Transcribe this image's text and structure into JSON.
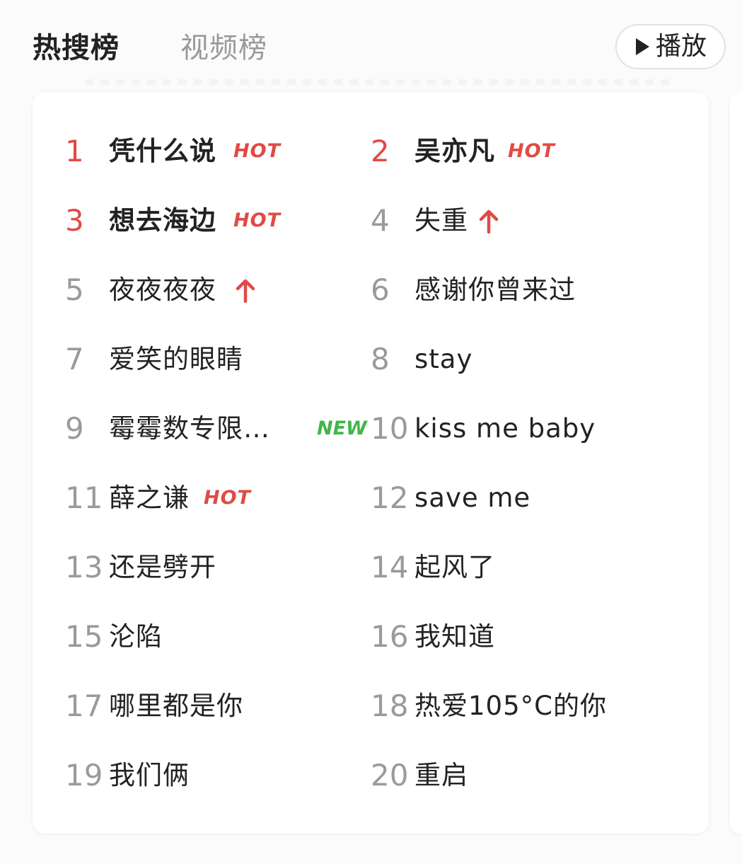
{
  "tabs": {
    "hot_search": "热搜榜",
    "video": "视频榜"
  },
  "play_button": {
    "label": "播放",
    "icon": "play-triangle-icon"
  },
  "colors": {
    "rank_top": "#e04b45",
    "rank_normal": "#9a9a9a",
    "hot_badge": "#e04b45",
    "new_badge": "#42b54a",
    "arrow_up": "#e04b45"
  },
  "items": [
    {
      "rank": "1",
      "title": "凭什么说",
      "badge": "HOT"
    },
    {
      "rank": "2",
      "title": "吴亦凡",
      "badge": "HOT"
    },
    {
      "rank": "3",
      "title": "想去海边",
      "badge": "HOT"
    },
    {
      "rank": "4",
      "title": "失重",
      "badge": "up-arrow-icon"
    },
    {
      "rank": "5",
      "title": "夜夜夜夜",
      "badge": "up-arrow-icon"
    },
    {
      "rank": "6",
      "title": "感谢你曾来过",
      "badge": ""
    },
    {
      "rank": "7",
      "title": "爱笑的眼睛",
      "badge": ""
    },
    {
      "rank": "8",
      "title": "stay",
      "badge": ""
    },
    {
      "rank": "9",
      "title": "霉霉数专限…",
      "badge": "NEW"
    },
    {
      "rank": "10",
      "title": "kiss me baby",
      "badge": ""
    },
    {
      "rank": "11",
      "title": "薛之谦",
      "badge": "HOT"
    },
    {
      "rank": "12",
      "title": "save me",
      "badge": ""
    },
    {
      "rank": "13",
      "title": "还是劈开",
      "badge": ""
    },
    {
      "rank": "14",
      "title": "起风了",
      "badge": ""
    },
    {
      "rank": "15",
      "title": "沦陷",
      "badge": ""
    },
    {
      "rank": "16",
      "title": "我知道",
      "badge": ""
    },
    {
      "rank": "17",
      "title": "哪里都是你",
      "badge": ""
    },
    {
      "rank": "18",
      "title": "热爱105°C的你",
      "badge": ""
    },
    {
      "rank": "19",
      "title": "我们俩",
      "badge": ""
    },
    {
      "rank": "20",
      "title": "重启",
      "badge": ""
    }
  ]
}
